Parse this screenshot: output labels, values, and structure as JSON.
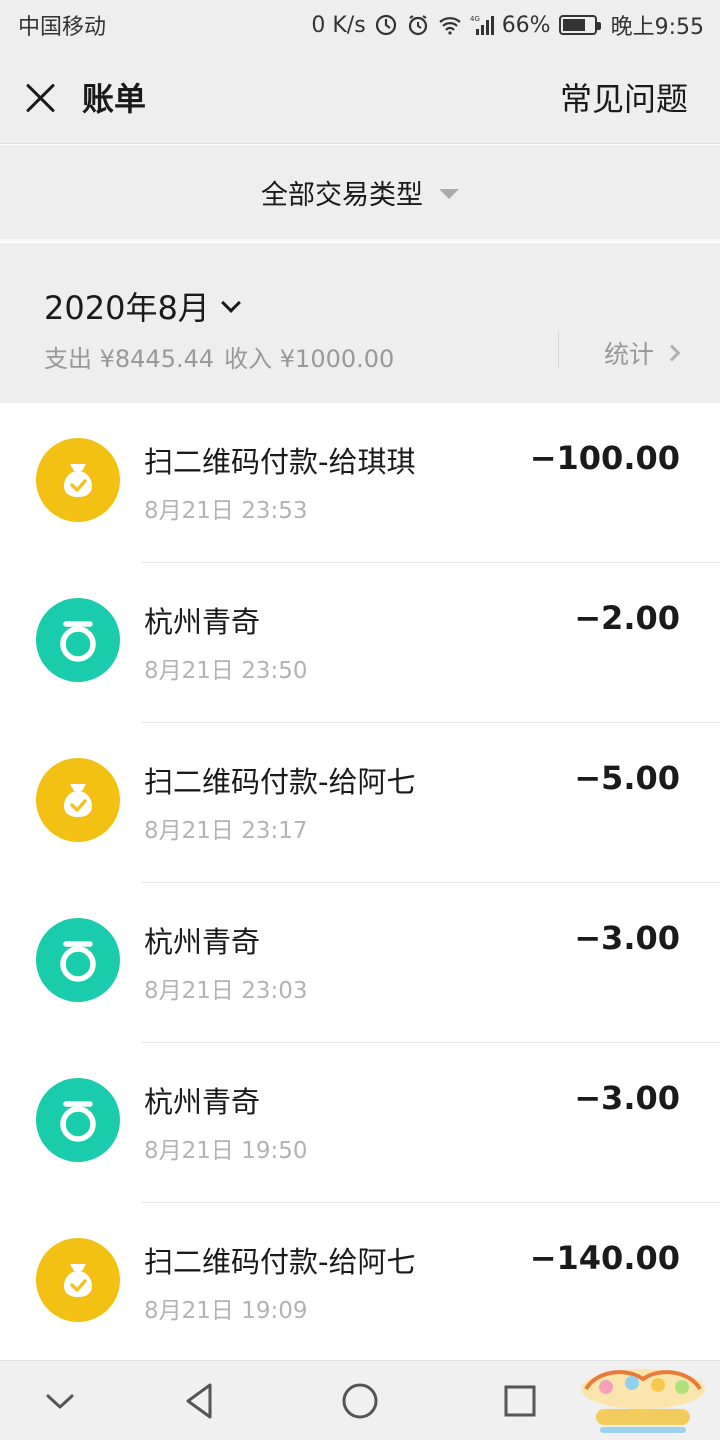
{
  "status_bar": {
    "carrier": "中国移动",
    "network_speed": "0 K/s",
    "network_type": "4G",
    "battery": "66%",
    "time": "晚上9:55",
    "icons": [
      "data-saver-icon",
      "alarm-icon",
      "wifi-icon",
      "signal-icon",
      "battery-icon"
    ]
  },
  "header": {
    "title": "账单",
    "faq": "常见问题"
  },
  "filter": {
    "label": "全部交易类型"
  },
  "summary": {
    "month": "2020年8月",
    "expense": "支出 ¥8445.44",
    "income": "收入 ¥1000.00",
    "stats": "统计"
  },
  "colors": {
    "qr_payment": "#F2C113",
    "merchant": "#19CCAC",
    "page_bg": "#EEEEEE"
  },
  "transactions": [
    {
      "title": "扫二维码付款-给琪琪",
      "time": "8月21日 23:53",
      "amount": "−100.00",
      "icon": "money-bag-icon"
    },
    {
      "title": "杭州青奇",
      "time": "8月21日 23:50",
      "amount": "−2.00",
      "icon": "merchant-ring-icon"
    },
    {
      "title": "扫二维码付款-给阿七",
      "time": "8月21日 23:17",
      "amount": "−5.00",
      "icon": "money-bag-icon"
    },
    {
      "title": "杭州青奇",
      "time": "8月21日 23:03",
      "amount": "−3.00",
      "icon": "merchant-ring-icon"
    },
    {
      "title": "杭州青奇",
      "time": "8月21日 19:50",
      "amount": "−3.00",
      "icon": "merchant-ring-icon"
    },
    {
      "title": "扫二维码付款-给阿七",
      "time": "8月21日 19:09",
      "amount": "−140.00",
      "icon": "money-bag-icon"
    }
  ],
  "nav": {
    "icons": [
      "collapse-icon",
      "back-icon",
      "home-icon",
      "recents-icon"
    ]
  }
}
